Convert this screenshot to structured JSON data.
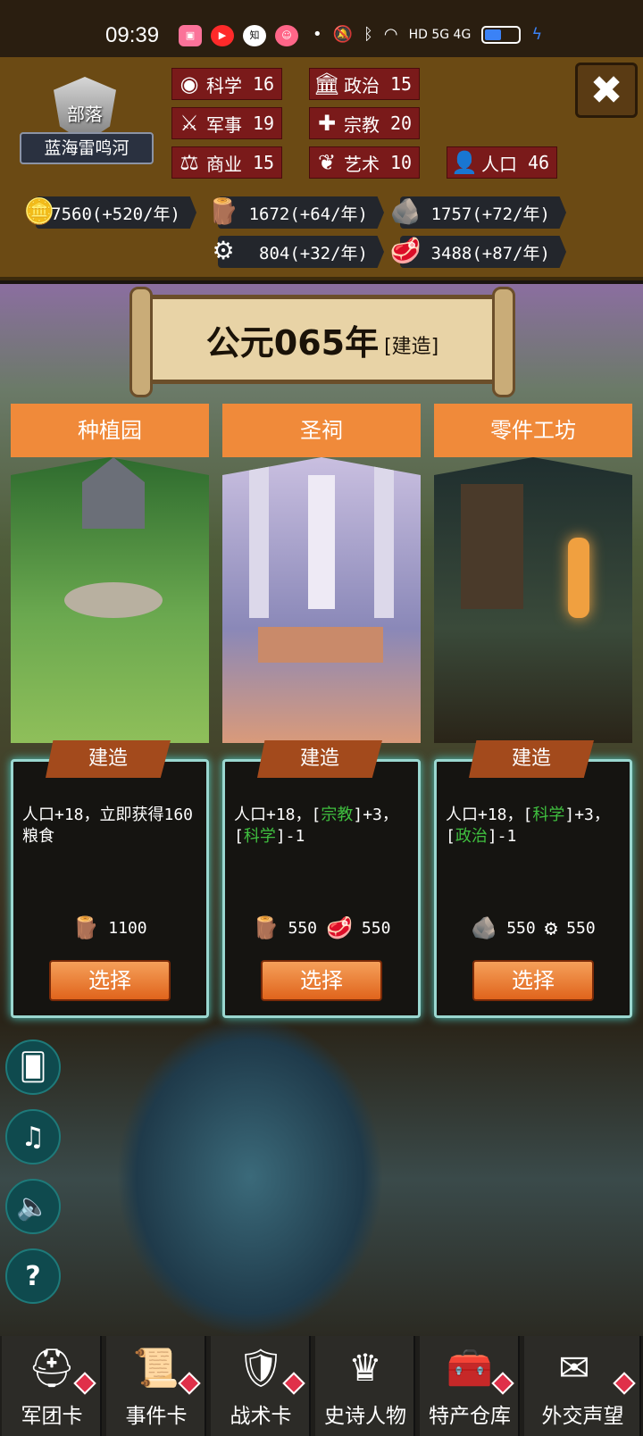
{
  "status_bar": {
    "time": "09:39",
    "apps": [
      "bilibili",
      "video",
      "知",
      "emoji"
    ],
    "network": "HD 5G 4G"
  },
  "header": {
    "tribe_type": "部落",
    "tribe_name": "蓝海雷鸣河",
    "stats": [
      {
        "icon": "planet-icon",
        "label": "科学",
        "value": "16"
      },
      {
        "icon": "capitol-icon",
        "label": "政治",
        "value": "15"
      },
      {
        "icon": "crossed-swords-icon",
        "label": "军事",
        "value": "19"
      },
      {
        "icon": "cross-icon",
        "label": "宗教",
        "value": "20"
      },
      {
        "icon": "scales-icon",
        "label": "商业",
        "value": "15"
      },
      {
        "icon": "lotus-icon",
        "label": "艺术",
        "value": "10"
      },
      {
        "icon": "person-icon",
        "label": "人口",
        "value": "46"
      }
    ],
    "resources": [
      {
        "icon": "gold-coins-icon",
        "value": "27560(+520/年)"
      },
      {
        "icon": "wood-logs-icon",
        "value": "1672(+64/年)"
      },
      {
        "icon": "stone-icon",
        "value": "1757(+72/年)"
      },
      {
        "icon": "machine-parts-icon",
        "value": "804(+32/年)"
      },
      {
        "icon": "meat-icon",
        "value": "3488(+87/年)"
      }
    ]
  },
  "title": {
    "year": "公元065年",
    "mode": "[建造]"
  },
  "cards": [
    {
      "name": "种植园",
      "ribbon": "建造",
      "desc_parts": [
        {
          "t": "人口+18，立即获得160粮食",
          "g": false
        }
      ],
      "costs": [
        {
          "icon": "wood-logs-icon",
          "value": "1100"
        }
      ],
      "select": "选择",
      "colors": [
        "#2e6b2e",
        "#6aa84f",
        "#8fbf5a"
      ]
    },
    {
      "name": "圣祠",
      "ribbon": "建造",
      "desc_parts": [
        {
          "t": "人口+18，[",
          "g": false
        },
        {
          "t": "宗教",
          "g": true
        },
        {
          "t": "]+3，[",
          "g": false
        },
        {
          "t": "科学",
          "g": true
        },
        {
          "t": "]-1",
          "g": false
        }
      ],
      "costs": [
        {
          "icon": "wood-logs-icon",
          "value": "550"
        },
        {
          "icon": "meat-icon",
          "value": "550"
        }
      ],
      "select": "选择",
      "colors": [
        "#c9bfe0",
        "#8a88b8",
        "#d99a7a"
      ]
    },
    {
      "name": "零件工坊",
      "ribbon": "建造",
      "desc_parts": [
        {
          "t": "人口+18，[",
          "g": false
        },
        {
          "t": "科学",
          "g": true
        },
        {
          "t": "]+3，[",
          "g": false
        },
        {
          "t": "政治",
          "g": true
        },
        {
          "t": "]-1",
          "g": false
        }
      ],
      "costs": [
        {
          "icon": "stone-icon",
          "value": "550"
        },
        {
          "icon": "machine-parts-icon",
          "value": "550"
        }
      ],
      "select": "选择",
      "colors": [
        "#1f2e2e",
        "#3a4a3a",
        "#c98a3a"
      ]
    }
  ],
  "side_buttons": [
    {
      "name": "cards-side-button",
      "icon": "cards-icon"
    },
    {
      "name": "music-side-button",
      "icon": "music-note-icon"
    },
    {
      "name": "sound-side-button",
      "icon": "speaker-icon"
    },
    {
      "name": "help-side-button",
      "icon": "question-icon"
    }
  ],
  "bottom_tabs": [
    {
      "label": "军团卡",
      "icon": "helmet-icon"
    },
    {
      "label": "事件卡",
      "icon": "scroll-icon"
    },
    {
      "label": "战术卡",
      "icon": "shield-swords-icon"
    },
    {
      "label": "史诗人物",
      "icon": "crown-icon"
    },
    {
      "label": "特产仓库",
      "icon": "treasure-chest-icon"
    },
    {
      "label": "外交声望",
      "icon": "envelope-icon"
    }
  ]
}
